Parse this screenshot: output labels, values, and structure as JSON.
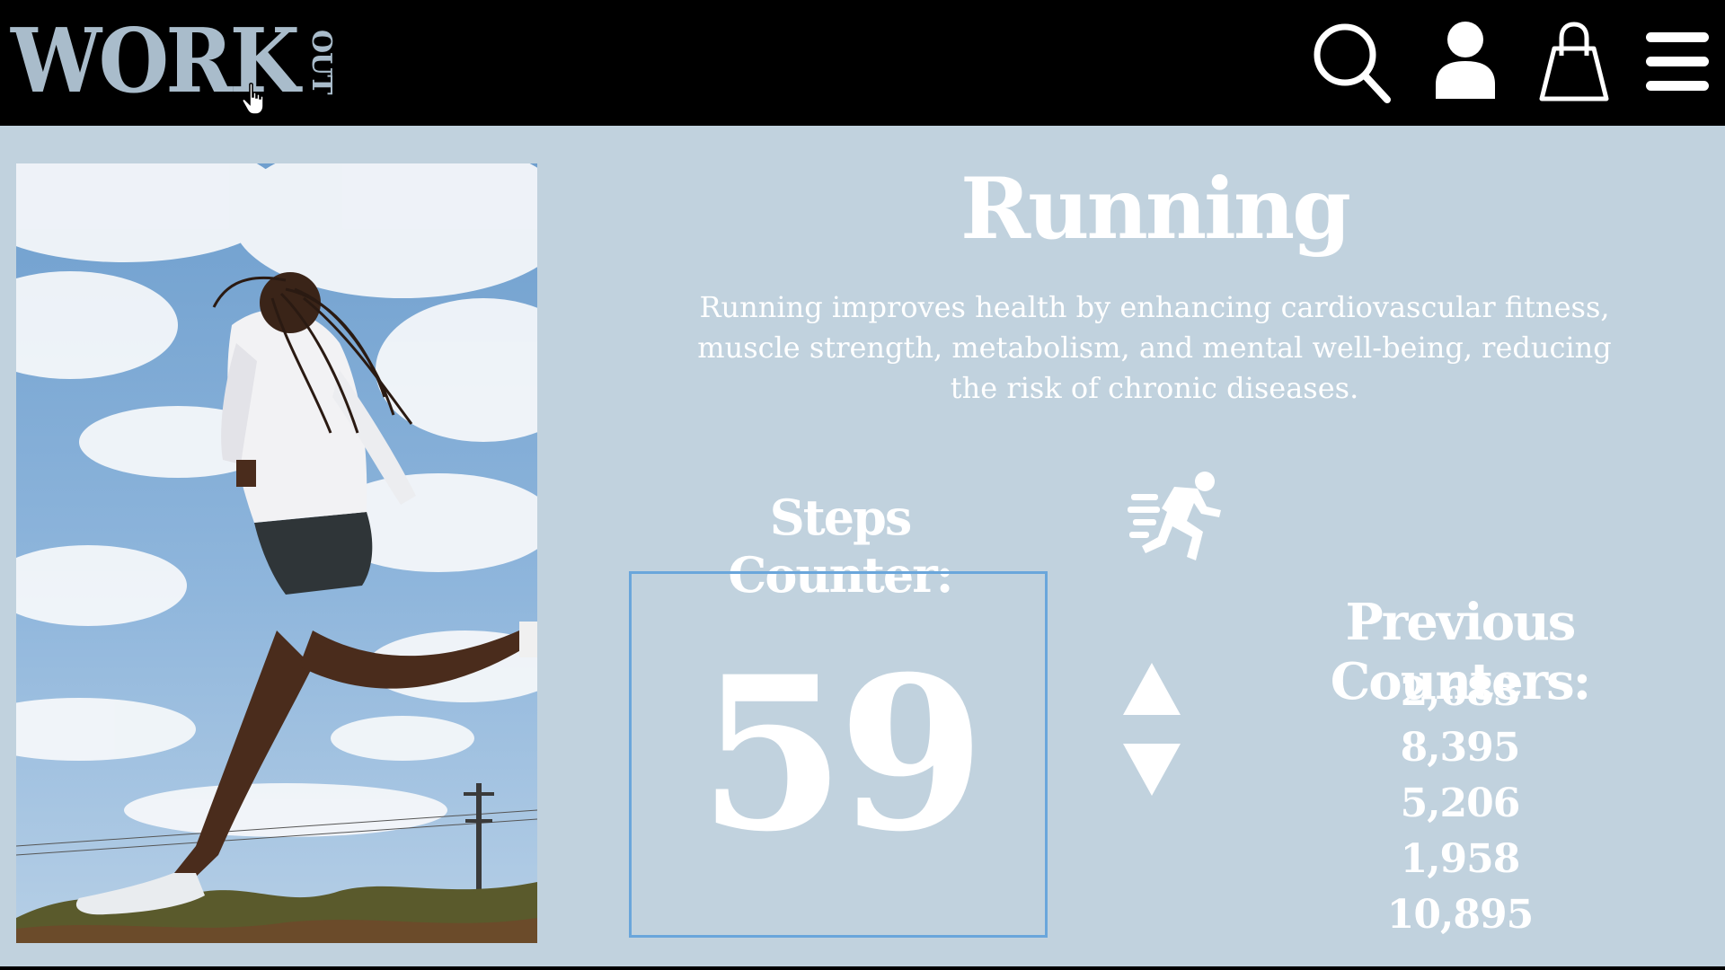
{
  "header": {
    "logo_main": "WORK",
    "logo_side": "OUT",
    "icons": [
      "search-icon",
      "user-icon",
      "shopping-bag-icon",
      "menu-icon"
    ]
  },
  "main": {
    "title": "Running",
    "description": "Running improves health by enhancing cardiovascular fitness, muscle strength, metabolism, and mental well-being, reducing the risk of chronic diseases.",
    "steps_label": "Steps Counter:",
    "steps_value": "59",
    "previous_label": "Previous Counters:",
    "previous_counters": [
      "2,683",
      "8,395",
      "5,206",
      "1,958",
      "10,895"
    ]
  },
  "colors": {
    "header_bg": "#000000",
    "page_bg": "#c1d2de",
    "logo": "#a9bccb",
    "text": "#ffffff",
    "counter_border": "#6aa6db"
  }
}
